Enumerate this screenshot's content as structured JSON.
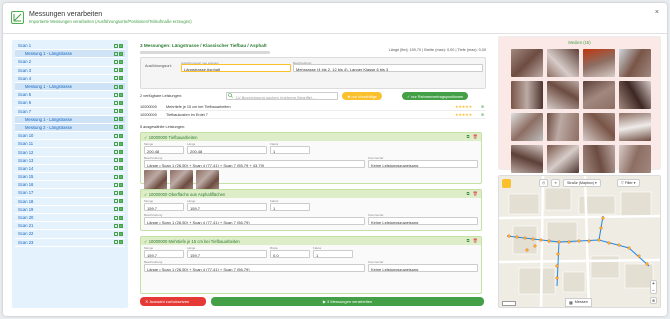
{
  "header": {
    "title": "Messungen verarbeiten",
    "subtitle": "Importierte Messungen verarbeiten (Ausführungsorte/Positionen/Teilsufmaße erzeugen)",
    "close_icon": "×"
  },
  "scans": [
    {
      "label": "Scan 1",
      "sub": false
    },
    {
      "label": "Messung 1 - Längstrasse",
      "sub": true
    },
    {
      "label": "Scan 2",
      "sub": false
    },
    {
      "label": "Scan 3",
      "sub": false
    },
    {
      "label": "Scan 4",
      "sub": false
    },
    {
      "label": "Messung 1 - Längstrasse",
      "sub": true
    },
    {
      "label": "Scan 5",
      "sub": false
    },
    {
      "label": "Scan 6",
      "sub": false
    },
    {
      "label": "Scan 7",
      "sub": false
    },
    {
      "label": "Messung 1 - Längstrasse",
      "sub": true
    },
    {
      "label": "Messung 2 - Längstrasse",
      "sub": true
    },
    {
      "label": "Scan 10",
      "sub": false
    },
    {
      "label": "Scan 11",
      "sub": false
    },
    {
      "label": "Scan 12",
      "sub": false
    },
    {
      "label": "Scan 13",
      "sub": false
    },
    {
      "label": "Scan 14",
      "sub": false
    },
    {
      "label": "Scan 15",
      "sub": false
    },
    {
      "label": "Scan 16",
      "sub": false
    },
    {
      "label": "Scan 17",
      "sub": false
    },
    {
      "label": "Scan 18",
      "sub": false
    },
    {
      "label": "Scan 19",
      "sub": false
    },
    {
      "label": "Scan 20",
      "sub": false
    },
    {
      "label": "Scan 21",
      "sub": false
    },
    {
      "label": "Scan 22",
      "sub": false
    },
    {
      "label": "Scan 23",
      "sub": false
    }
  ],
  "main": {
    "heading": "3 Messungen: Längstrasse / Klassischer Tiefbau / Asphalt",
    "stats": "Länge [lfm]: 159,70  |  Breite (max): 0,00  |  Tiefe (max): 0,00",
    "ausfuehrungsort_label": "Ausführungsort:",
    "ort_field_label": "Ausführungsort neu anlegen",
    "ort_value": "Längstrasse Asphalt",
    "beschreibung_label": "Beschreibung",
    "beschreibung_value": "Mehrgasse (4 bis 2, 12 bis 4), Langer Klasse 6 bis 3",
    "available_label": "2 verfügbare Leistungen:",
    "search_placeholder": "LV-Bezeichnung suchen (mehrere Begriffe)...",
    "btn_suggestions": "nur Vorschläge",
    "btn_frame": "nur Rahmenvertragspositionen",
    "available": [
      {
        "nr": "10000000",
        "text": "Mehrtiefe je 15 cm bei Tiefbauarbeiten"
      },
      {
        "nr": "10000000",
        "text": "Tiefbaukosten im Erdel 7"
      }
    ],
    "selected_label": "5 ausgewählte Leistungen:",
    "measures": [
      {
        "nr": "10000000",
        "title": "Tiefbauarbeiten",
        "menge": "200,48",
        "laenge": "200,48",
        "faktor": "1",
        "formula": "Länge • Scan 1 (26.50) + Scan 4 (77.41) + Scan 7 (55.79 + 43.79)",
        "zuweisung": "Keine Leistungszuweisung"
      },
      {
        "nr": "10000000",
        "title": "Oberfläche aus Asphaltflächen",
        "menge": "159,7",
        "laenge": "159,7",
        "faktor": "1",
        "formula": "Länge • Scan 1 (26.50) + Scan 4 (77.41) + Scan 7 (56.79)",
        "zuweisung": "Keine Leistungszuweisung"
      },
      {
        "nr": "10000000",
        "title": "Mehrtiefe je 15 cm bei Tiefbauarbeiten",
        "menge": "159,7",
        "laenge": "159,7",
        "breite": "0,0",
        "faktor": "1",
        "formula": "Länge • Scan 1 (26.50) + Scan 4 (77.41) + Scan 7 (56.79)",
        "zuweisung": "Keine Leistungszuweisung"
      }
    ],
    "label_menge": "Menge",
    "label_laenge": "Länge",
    "label_breite": "Breite",
    "label_faktor": "Faktor",
    "label_beschreibung": "Beschreibung",
    "label_kommentar": "Kommentar",
    "btn_cancel": "Auswahl zurücksetzen",
    "btn_process": "3 Messungen verarbeiten"
  },
  "media": {
    "title": "Medien (15)"
  },
  "map": {
    "style_label": "Straße (Mapbox)",
    "filter_label": "Filter",
    "legend_label": "Messen"
  }
}
